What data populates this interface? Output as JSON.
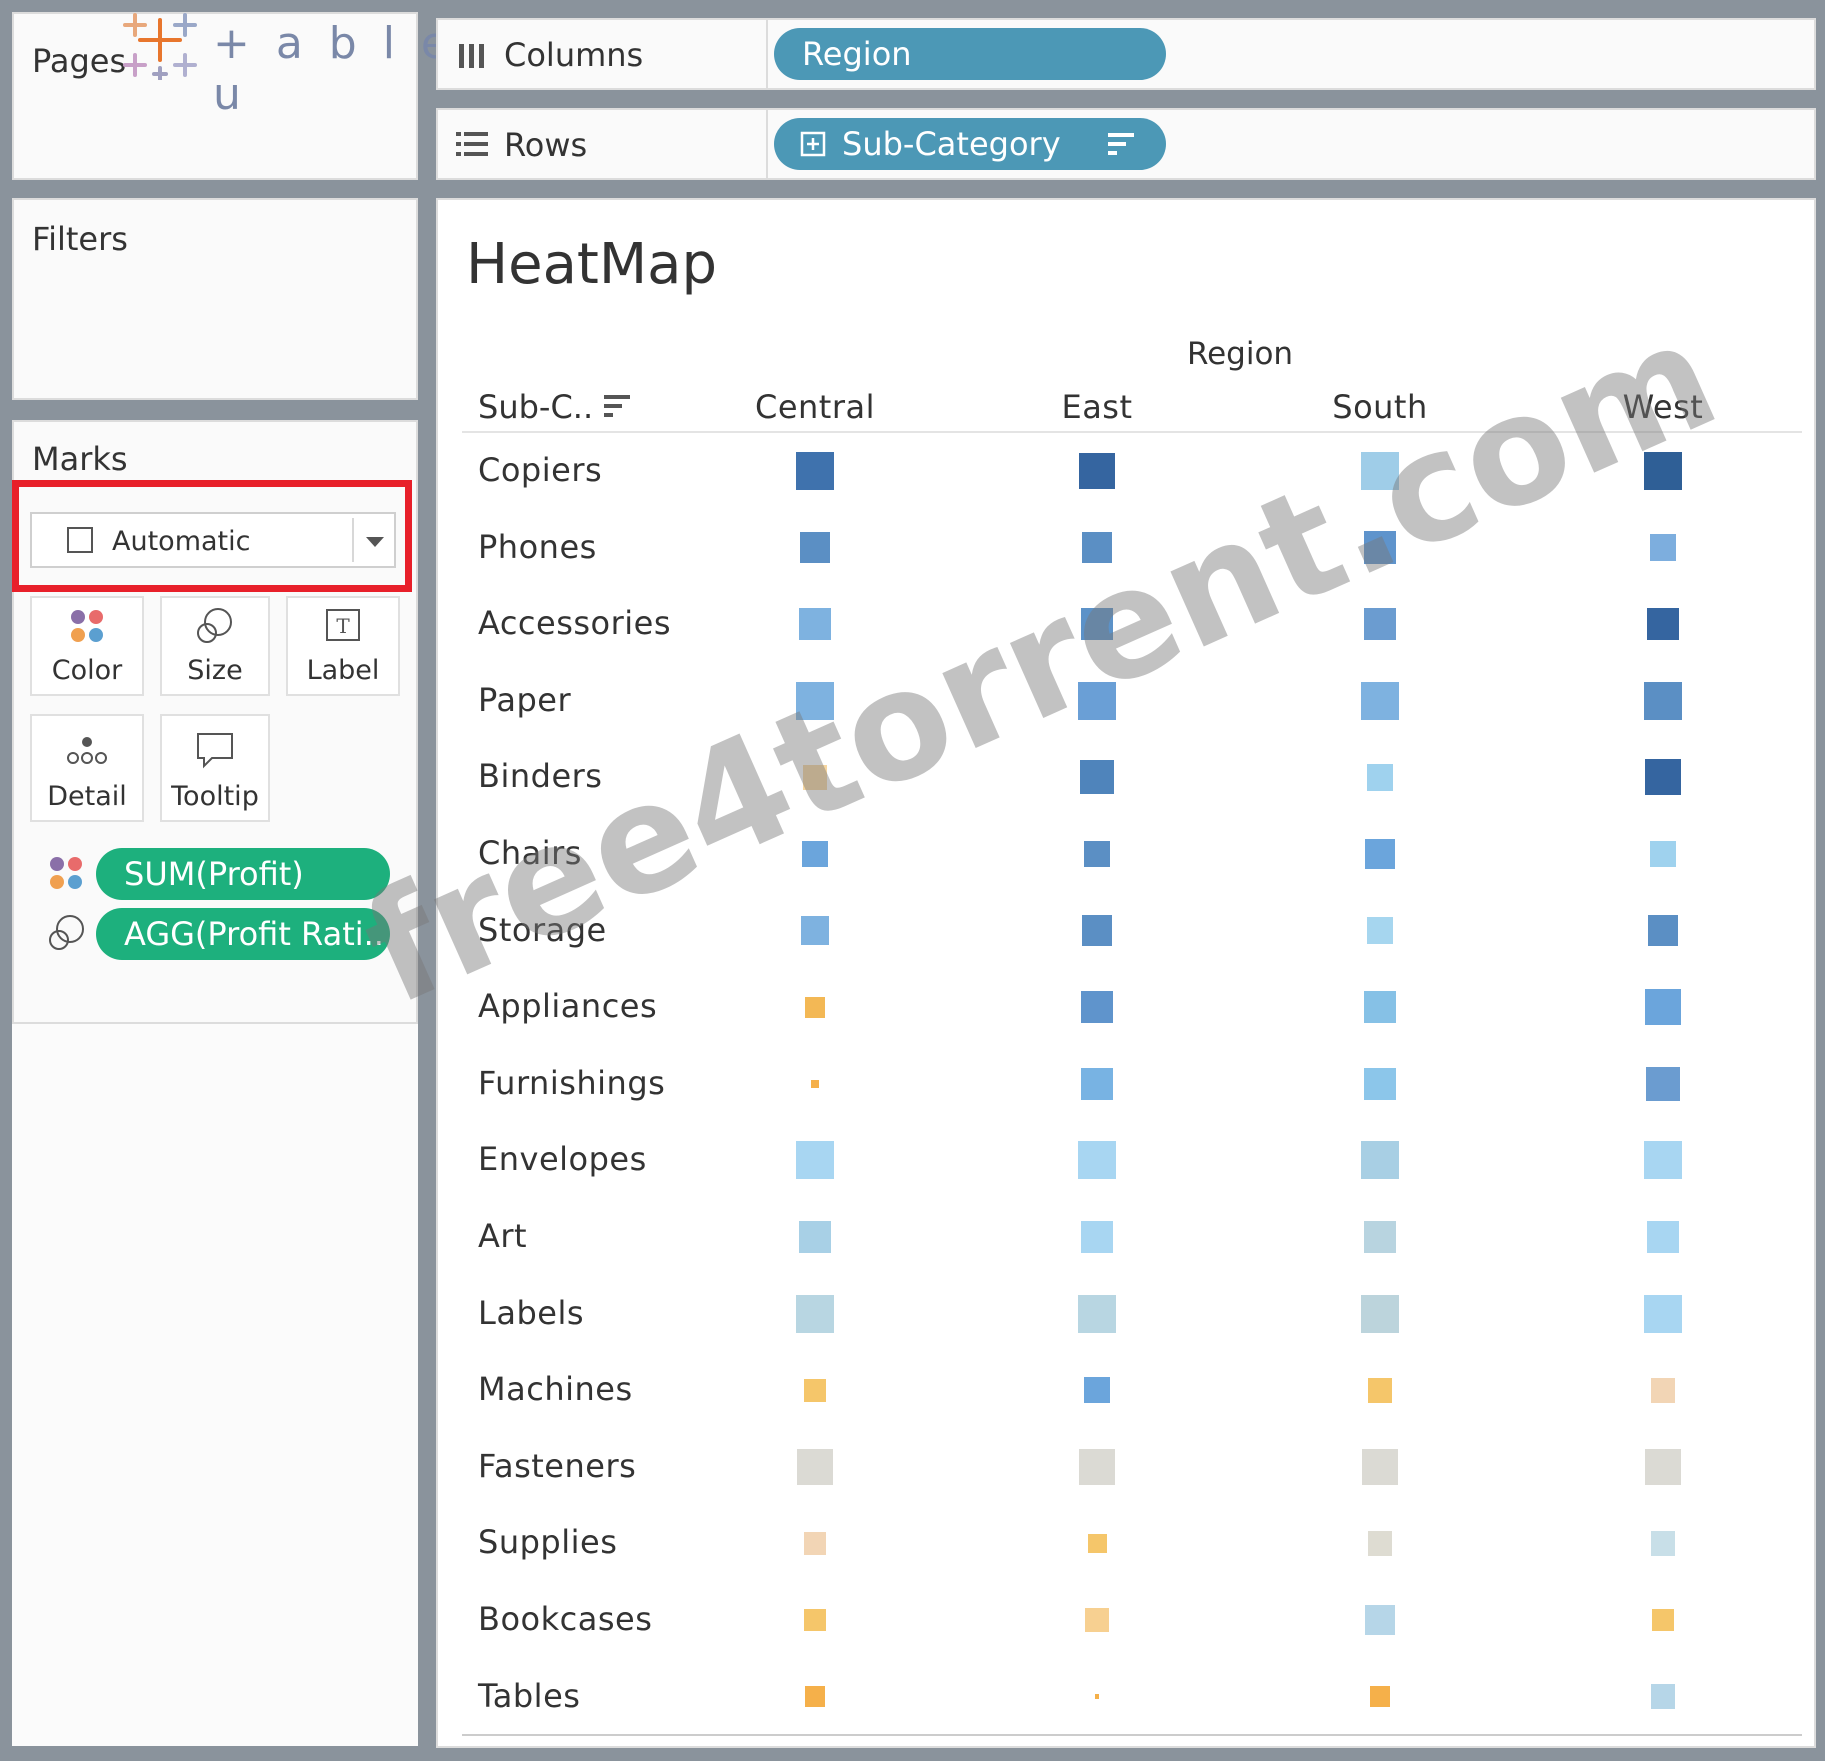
{
  "logo": {
    "text": "+ a b l e a u"
  },
  "pages": {
    "label": "Pages"
  },
  "columns_shelf": {
    "label": "Columns",
    "pill": "Region"
  },
  "rows_shelf": {
    "label": "Rows",
    "pill": "Sub-Category"
  },
  "filters": {
    "label": "Filters"
  },
  "marks": {
    "label": "Marks",
    "mark_type": "Automatic",
    "cards": {
      "color": "Color",
      "size": "Size",
      "label": "Label",
      "detail": "Detail",
      "tooltip": "Tooltip"
    },
    "pills": {
      "color_field": "SUM(Profit)",
      "size_field": "AGG(Profit Rati.."
    }
  },
  "colors": {
    "accent_blue": "#4c98b6",
    "pill_green": "#1db07d",
    "highlight_red": "#e8202a"
  },
  "view": {
    "title": "HeatMap",
    "column_header_title": "Region",
    "row_header_title": "Sub-C..",
    "watermark": "free4torrent.com"
  },
  "chart_data": {
    "type": "heatmap",
    "title": "HeatMap",
    "x_title": "Region",
    "y_title": "Sub-C..",
    "x": [
      "Central",
      "East",
      "South",
      "West"
    ],
    "y": [
      "Copiers",
      "Phones",
      "Accessories",
      "Paper",
      "Binders",
      "Chairs",
      "Storage",
      "Appliances",
      "Furnishings",
      "Envelopes",
      "Art",
      "Labels",
      "Machines",
      "Fasteners",
      "Supplies",
      "Bookcases",
      "Tables"
    ],
    "color": "SUM(Profit)",
    "size": "AGG(Profit Ratio)",
    "cell_colors": [
      [
        "#3f72ad",
        "#3565a0",
        "#9fcde8",
        "#2f5f96"
      ],
      [
        "#5b8fc4",
        "#5b8fc4",
        "#5f94cc",
        "#7daede"
      ],
      [
        "#7eb2e0",
        "#5c92c8",
        "#6b9cd0",
        "#3565a0"
      ],
      [
        "#7eb2e0",
        "#6a9fd6",
        "#7eb2e0",
        "#5b8fc4"
      ],
      [
        "#f6d6a0",
        "#4f84bb",
        "#9fd2ee",
        "#3565a0"
      ],
      [
        "#6ba5dc",
        "#5b8fc4",
        "#6ba5dc",
        "#9fd2ee"
      ],
      [
        "#7eb2e0",
        "#5b8fc4",
        "#a6d6ef",
        "#5b8fc4"
      ],
      [
        "#f3b855",
        "#5f94cc",
        "#86c1e6",
        "#6ba5dc"
      ],
      [
        "#f5b04a",
        "#78b3e3",
        "#8cc6ea",
        "#6b9cd0"
      ],
      [
        "#a8d6f2",
        "#a8d6f2",
        "#a8cfe4",
        "#a8d6f2"
      ],
      [
        "#a8d0e6",
        "#a8d6f2",
        "#b8d4e0",
        "#a8d6f2"
      ],
      [
        "#b8d6e2",
        "#b8d6e2",
        "#bcd4dc",
        "#a8d6f2"
      ],
      [
        "#f5c66a",
        "#6ba5dc",
        "#f5c66a",
        "#f2d5b5"
      ],
      [
        "#dbdad4",
        "#dbdad4",
        "#dbdad4",
        "#dbdad4"
      ],
      [
        "#f2d5b5",
        "#f5c66a",
        "#dedcd2",
        "#c8dfe8"
      ],
      [
        "#f5c66a",
        "#f7d091",
        "#b6d6e8",
        "#f5c66a"
      ],
      [
        "#f5b04a",
        "#f5b04a",
        "#f5b04a",
        "#b6d6e8"
      ]
    ],
    "cell_sizes": [
      [
        1.0,
        0.95,
        1.0,
        1.0
      ],
      [
        0.8,
        0.8,
        0.85,
        0.7
      ],
      [
        0.85,
        0.85,
        0.85,
        0.85
      ],
      [
        1.0,
        1.0,
        1.0,
        1.0
      ],
      [
        0.65,
        0.9,
        0.7,
        0.95
      ],
      [
        0.7,
        0.7,
        0.8,
        0.7
      ],
      [
        0.75,
        0.8,
        0.7,
        0.8
      ],
      [
        0.55,
        0.85,
        0.85,
        0.95
      ],
      [
        0.2,
        0.85,
        0.85,
        0.9
      ],
      [
        1.0,
        1.0,
        1.0,
        1.0
      ],
      [
        0.85,
        0.85,
        0.85,
        0.85
      ],
      [
        1.0,
        1.0,
        1.0,
        1.0
      ],
      [
        0.6,
        0.7,
        0.65,
        0.65
      ],
      [
        0.95,
        0.95,
        0.95,
        0.95
      ],
      [
        0.6,
        0.5,
        0.65,
        0.65
      ],
      [
        0.6,
        0.65,
        0.8,
        0.6
      ],
      [
        0.55,
        0.12,
        0.55,
        0.65
      ]
    ]
  }
}
